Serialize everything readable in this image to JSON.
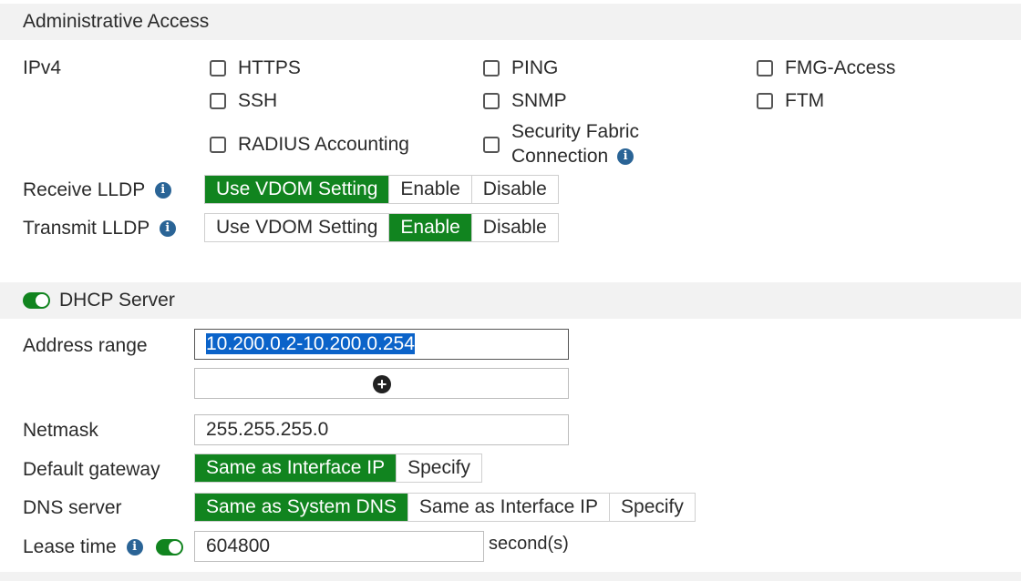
{
  "admin": {
    "section_title": "Administrative Access",
    "ipv4_label": "IPv4",
    "options": {
      "https": "HTTPS",
      "ping": "PING",
      "fmg": "FMG-Access",
      "ssh": "SSH",
      "snmp": "SNMP",
      "ftm": "FTM",
      "radius": "RADIUS Accounting",
      "fabric_line1": "Security Fabric",
      "fabric_line2": "Connection"
    },
    "receive_lldp": {
      "label": "Receive LLDP",
      "opt1": "Use VDOM Setting",
      "opt2": "Enable",
      "opt3": "Disable",
      "selected": "Use VDOM Setting"
    },
    "transmit_lldp": {
      "label": "Transmit LLDP",
      "opt1": "Use VDOM Setting",
      "opt2": "Enable",
      "opt3": "Disable",
      "selected": "Enable"
    }
  },
  "dhcp": {
    "section_title": "DHCP Server",
    "enabled": true,
    "address_range_label": "Address range",
    "address_range_value": "10.200.0.2-10.200.0.254",
    "netmask_label": "Netmask",
    "netmask_value": "255.255.255.0",
    "gateway_label": "Default gateway",
    "gateway_opt1": "Same as Interface IP",
    "gateway_opt2": "Specify",
    "gateway_selected": "Same as Interface IP",
    "dns_label": "DNS server",
    "dns_opt1": "Same as System DNS",
    "dns_opt2": "Same as Interface IP",
    "dns_opt3": "Specify",
    "dns_selected": "Same as System DNS",
    "lease_label": "Lease time",
    "lease_enabled": true,
    "lease_value": "604800",
    "lease_unit": "second(s)"
  },
  "colors": {
    "accent_green": "#11841f",
    "info_blue": "#2a6496",
    "selection_blue": "#0b63c9"
  }
}
